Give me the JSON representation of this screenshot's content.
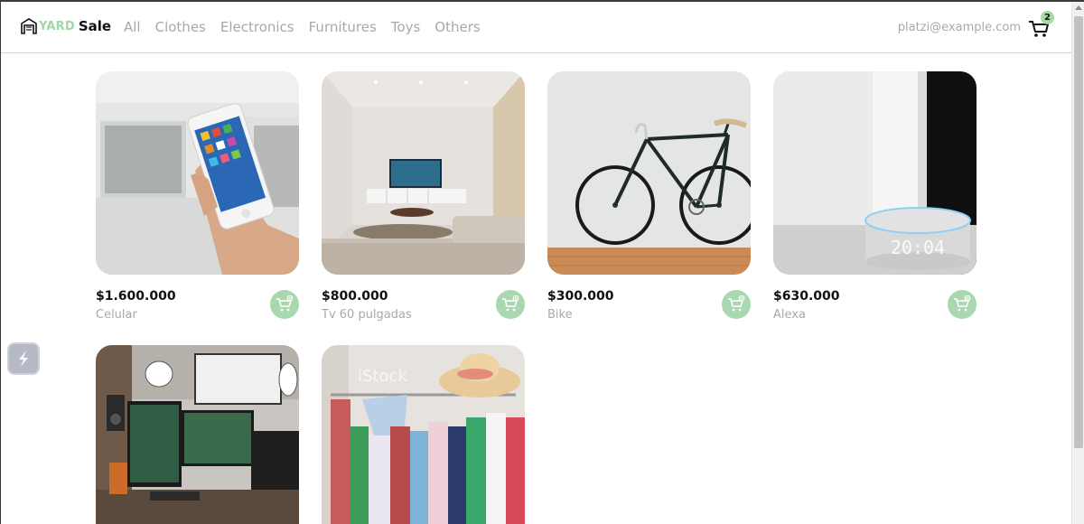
{
  "logo": {
    "yard": "YARD",
    "sale": "Sale"
  },
  "nav": {
    "links": [
      "All",
      "Clothes",
      "Electronics",
      "Furnitures",
      "Toys",
      "Others"
    ]
  },
  "user": {
    "email": "platzi@example.com"
  },
  "cart": {
    "count": "2"
  },
  "products": [
    {
      "price": "$1.600.000",
      "name": "Celular",
      "image": "phone-in-hand"
    },
    {
      "price": "$800.000",
      "name": "Tv 60 pulgadas",
      "image": "living-room-tv"
    },
    {
      "price": "$300.000",
      "name": "Bike",
      "image": "bicycle"
    },
    {
      "price": "$630.000",
      "name": "Alexa",
      "image": "smart-speaker-clock"
    },
    {
      "price": "",
      "name": "",
      "image": "desk-setup"
    },
    {
      "price": "",
      "name": "",
      "image": "clothes-rack"
    }
  ],
  "image_watermark": "iStock",
  "speaker_clock": "20:04",
  "colors": {
    "accent": "#a8d7b0",
    "logo_accent": "#9fd7a6",
    "muted_text": "#a8a8a8"
  },
  "icons": {
    "cart": "cart-icon",
    "add_to_cart": "add-to-cart-icon",
    "extension": "extension-icon"
  }
}
